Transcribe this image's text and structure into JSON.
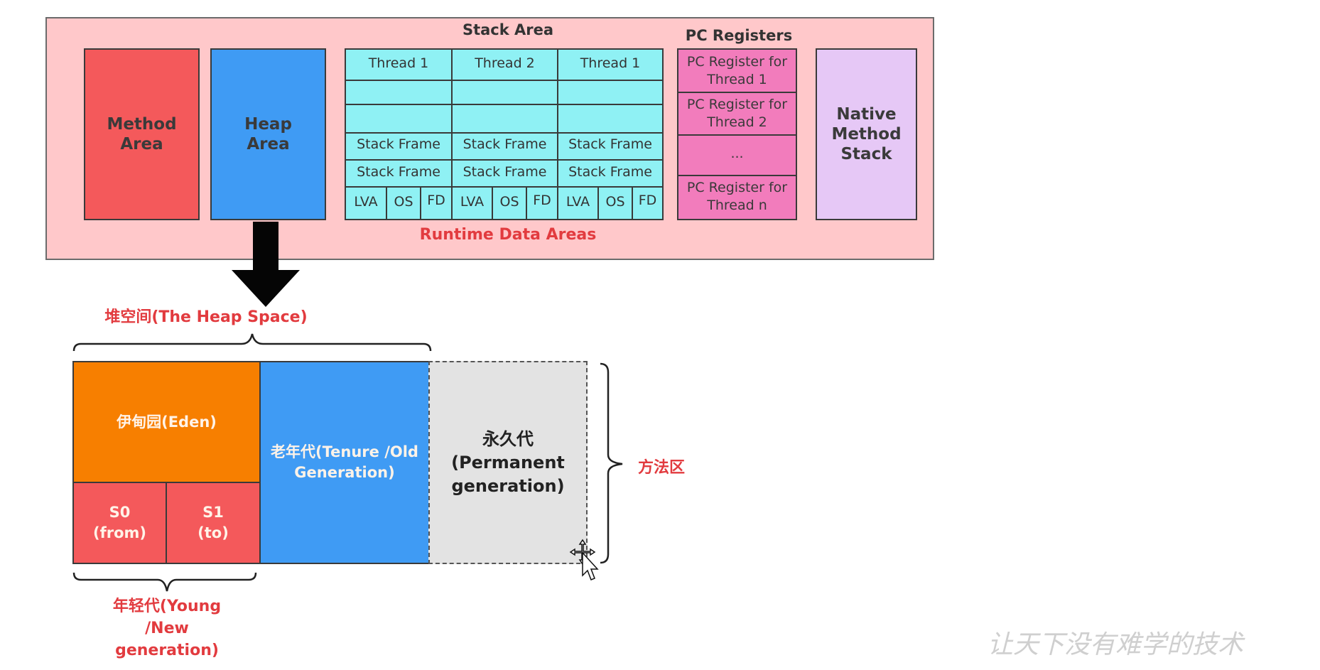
{
  "runtime": {
    "method_area": "Method\nArea",
    "heap_area": "Heap\nArea",
    "stack_area_title": "Stack Area",
    "pc_registers_title": "PC Registers",
    "native_method_stack": "Native\nMethod\nStack",
    "label": "Runtime Data Areas",
    "stack_columns": [
      {
        "thread": "Thread 1",
        "frames": [
          "Stack Frame",
          "Stack Frame"
        ],
        "lva": "LVA",
        "os": "OS",
        "fd": "FD"
      },
      {
        "thread": "Thread 2",
        "frames": [
          "Stack Frame",
          "Stack Frame"
        ],
        "lva": "LVA",
        "os": "OS",
        "fd": "FD"
      },
      {
        "thread": "Thread 1",
        "frames": [
          "Stack Frame",
          "Stack Frame"
        ],
        "lva": "LVA",
        "os": "OS",
        "fd": "FD"
      }
    ],
    "pc_registers": [
      "PC Register for\nThread 1",
      "PC Register for\nThread 2",
      "...",
      "PC Register for\nThread n"
    ]
  },
  "heap_detail": {
    "heap_space_label": "堆空间(The Heap Space)",
    "eden": "伊甸园(Eden)",
    "s0": "S0\n(from)",
    "s1": "S1\n(to)",
    "old": "老年代(Tenure /Old\nGeneration)",
    "perm": "永久代\n(Permanent\ngeneration)",
    "young_label": "年轻代(Young\n/New\ngeneration)",
    "method_zone_label": "方法区"
  },
  "watermark": "让天下没有难学的技术",
  "colors": {
    "rda_bg": "#ffc8ca",
    "method_area": "#f4595b",
    "heap_area": "#3f9bf4",
    "stack": "#8ff1f4",
    "pc": "#f27cbc",
    "native": "#e6c8f6",
    "eden": "#f77f00",
    "perm": "#e3e3e3",
    "label_red": "#e23b3f"
  }
}
